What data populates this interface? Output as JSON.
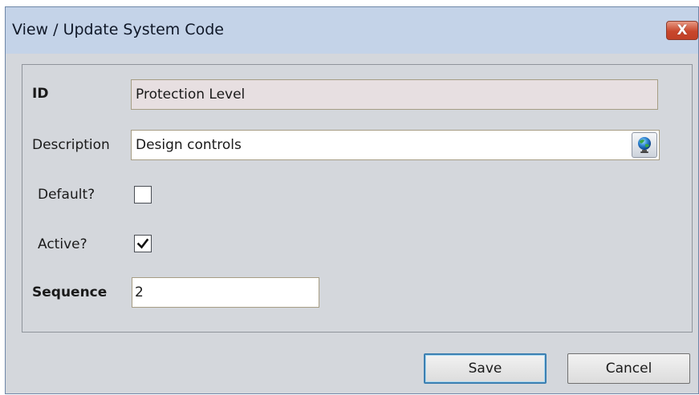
{
  "window": {
    "title": "View / Update System Code",
    "close_label": "X"
  },
  "form": {
    "id": {
      "label": "ID",
      "value": "Protection Level"
    },
    "description": {
      "label": "Description",
      "value": "Design controls"
    },
    "default": {
      "label": "Default?",
      "checked": false
    },
    "active": {
      "label": "Active?",
      "checked": true
    },
    "sequence": {
      "label": "Sequence",
      "value": "2"
    }
  },
  "buttons": {
    "save_label": "Save",
    "cancel_label": "Cancel"
  },
  "icons": {
    "globe": "globe-icon",
    "check": "checkmark-icon",
    "close": "close-icon"
  }
}
